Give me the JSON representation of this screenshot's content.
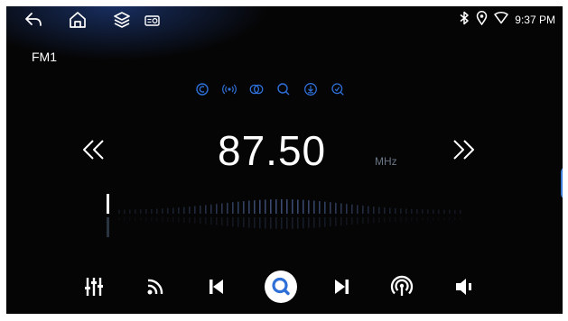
{
  "status": {
    "time": "9:37 PM"
  },
  "radio": {
    "band": "FM1",
    "frequency": "87.50",
    "unit": "MHz"
  },
  "colors": {
    "accent": "#3b7bd4",
    "tool_icon": "#2e6fd8",
    "muted_text": "#6a7686",
    "tick": "#3a4a70"
  },
  "icons": {
    "top_bar": [
      "back-icon",
      "home-icon",
      "layers-icon",
      "radio-icon"
    ],
    "status": [
      "bluetooth-icon",
      "location-icon",
      "wifi-icon"
    ],
    "tools": [
      "loop-icon",
      "broadcast-icon",
      "stereo-icon",
      "search-icon",
      "download-icon",
      "rescan-icon"
    ],
    "controls": [
      "equalizer-icon",
      "rss-icon",
      "previous-icon",
      "search-icon",
      "next-icon",
      "broadcast-icon",
      "volume-icon"
    ]
  },
  "tuner": {
    "position": 0.0
  }
}
